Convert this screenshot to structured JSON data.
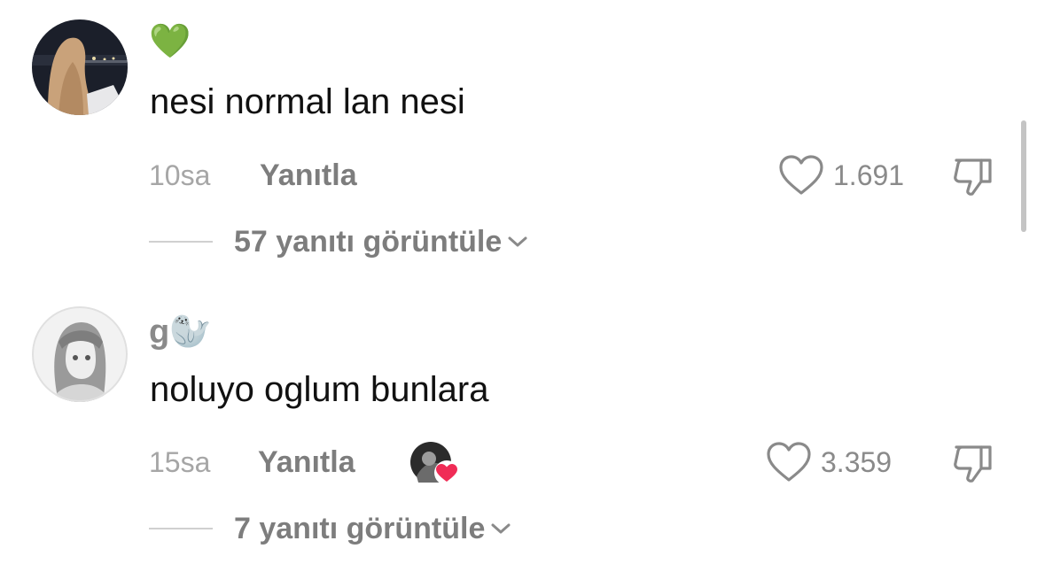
{
  "comments": [
    {
      "username": "💚",
      "text": "nesi normal lan nesi",
      "time": "10sa",
      "reply_label": "Yanıtla",
      "likes": "1.691",
      "view_replies": "57 yanıtı görüntüle"
    },
    {
      "username": "g🦭",
      "text": "noluyo oglum bunlara",
      "time": "15sa",
      "reply_label": "Yanıtla",
      "likes": "3.359",
      "view_replies": "7 yanıtı görüntüle",
      "liked_by_creator": true
    }
  ],
  "icons": {
    "like": "heart-outline-icon",
    "dislike": "thumbs-down-icon",
    "expand": "chevron-down-icon",
    "creator_badge": "red-heart-icon"
  },
  "colors": {
    "creator_heart": "#f02c56",
    "green_heart": "#78c552"
  }
}
